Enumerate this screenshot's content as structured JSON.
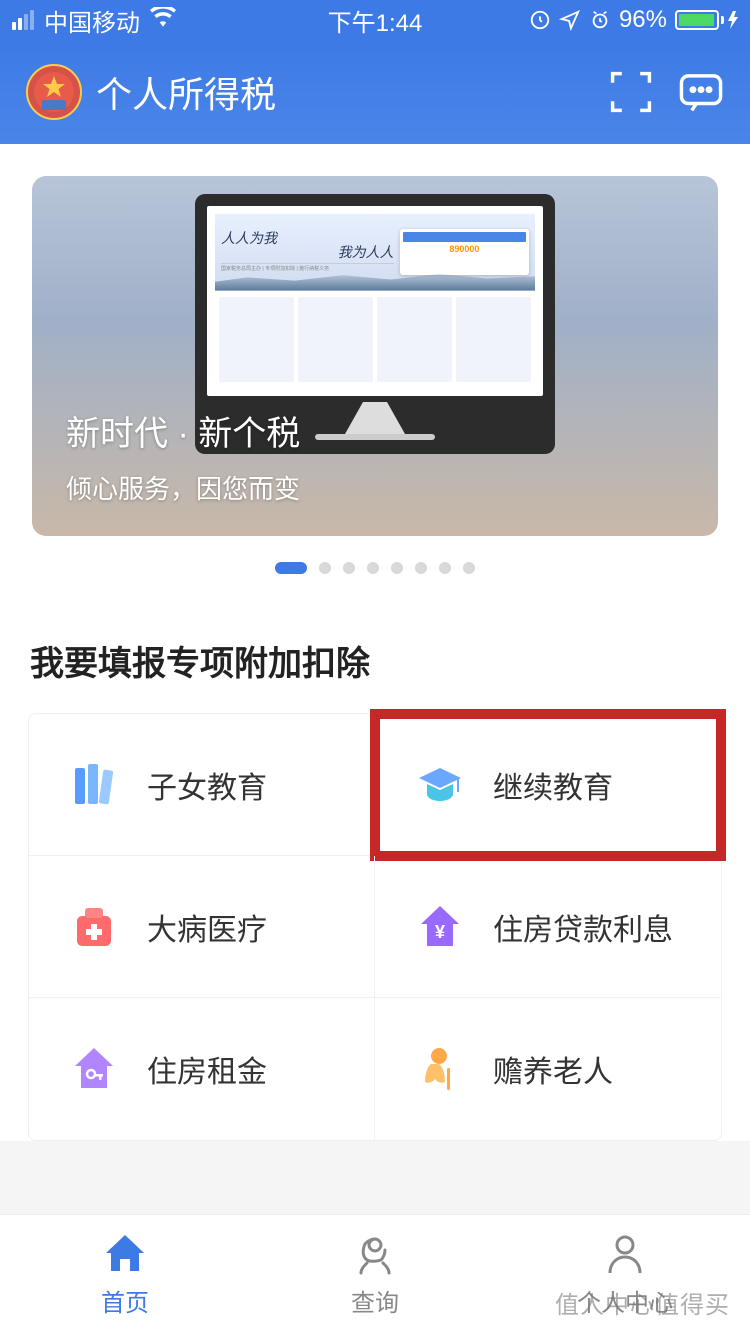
{
  "status": {
    "carrier": "中国移动",
    "time": "下午1:44",
    "battery_pct": "96%"
  },
  "header": {
    "title": "个人所得税"
  },
  "banner": {
    "script1": "人人为我",
    "script2": "我为人人",
    "sub": "国家税务总局主办 | 专项附加扣除 | 施行纳税义务",
    "stat": "890000",
    "title": "新时代 · 新个税",
    "subtitle": "倾心服务，因您而变"
  },
  "section": {
    "title": "我要填报专项附加扣除"
  },
  "grid": [
    {
      "label": "子女教育",
      "icon": "books-icon",
      "color1": "#5a9bff",
      "color2": "#7ab5ff"
    },
    {
      "label": "继续教育",
      "icon": "graduation-icon",
      "color1": "#6aa8ff",
      "color2": "#4ac5e8"
    },
    {
      "label": "大病医疗",
      "icon": "medical-icon",
      "color1": "#ff6b6b",
      "color2": "#ff8585"
    },
    {
      "label": "住房贷款利息",
      "icon": "loan-icon",
      "color1": "#9a6aff",
      "color2": "#b085ff"
    },
    {
      "label": "住房租金",
      "icon": "rent-icon",
      "color1": "#b085ff",
      "color2": "#9a6aff"
    },
    {
      "label": "赡养老人",
      "icon": "elder-icon",
      "color1": "#ffa84a",
      "color2": "#ffc06a"
    }
  ],
  "tabs": [
    {
      "label": "首页",
      "icon": "home-icon"
    },
    {
      "label": "查询",
      "icon": "query-icon"
    },
    {
      "label": "个人中心",
      "icon": "profile-icon"
    }
  ],
  "watermark": "值人中心值得买"
}
